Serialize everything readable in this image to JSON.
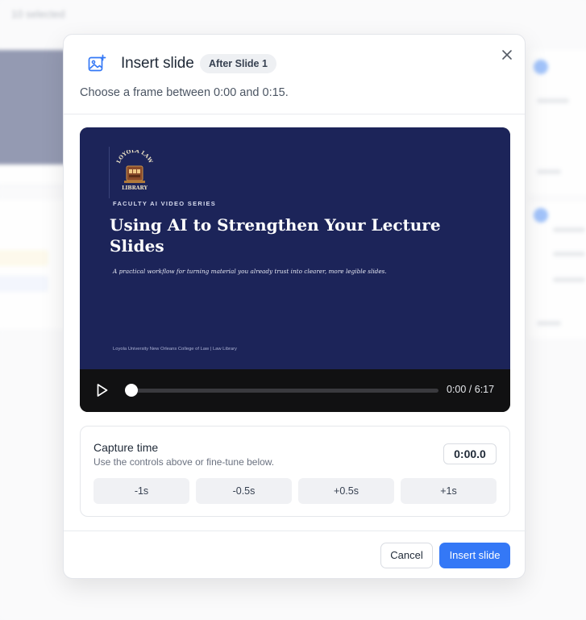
{
  "background": {
    "toolbar_selection": "10 selected"
  },
  "modal": {
    "title": "Insert slide",
    "position_badge": "After Slide 1",
    "subtitle": "Choose a frame between 0:00 and 0:15.",
    "close_icon": "close-icon",
    "header_icon": "image-plus-icon"
  },
  "video": {
    "slide": {
      "logo_text_top": "LOYOLA LAW",
      "logo_text_bottom": "LIBRARY",
      "series": "FACULTY AI VIDEO SERIES",
      "title": "Using AI to Strengthen Your Lecture Slides",
      "description": "A practical workflow for turning material you already trust into clearer, more legible slides.",
      "footer": "Loyola University New Orleans College of Law  |  Law Library"
    },
    "player": {
      "play_icon": "play-icon",
      "time": "0:00 / 6:17",
      "progress_fraction": 0
    }
  },
  "capture": {
    "title": "Capture time",
    "help": "Use the controls above or fine-tune below.",
    "value": "0:00.0",
    "steps": [
      "-1s",
      "-0.5s",
      "+0.5s",
      "+1s"
    ]
  },
  "footer": {
    "cancel_label": "Cancel",
    "insert_label": "Insert slide"
  },
  "colors": {
    "accent": "#3478f6",
    "slide_background": "#1c2459"
  }
}
